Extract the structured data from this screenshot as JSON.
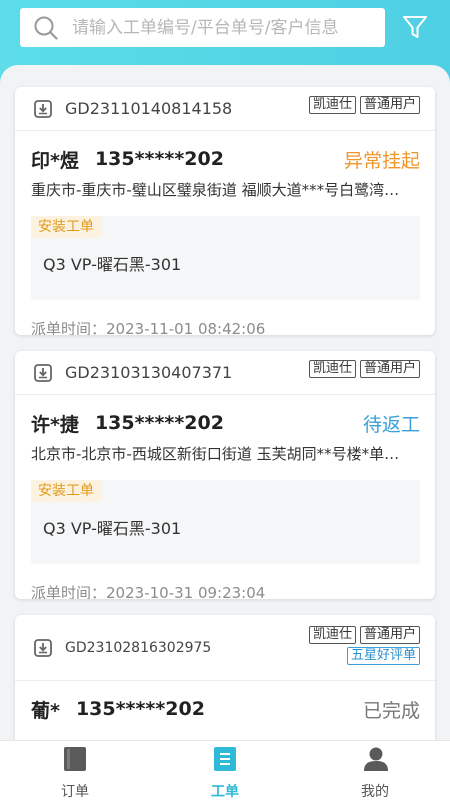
{
  "search": {
    "placeholder": "请输入工单编号/平台单号/客户信息",
    "value": ""
  },
  "colors": {
    "accent": "#2eb9d6",
    "status_suspended": "#f0962b",
    "status_pending_return": "#3aa0d8",
    "status_completed": "#777777",
    "header_bg": "#54d6e6"
  },
  "orders": [
    {
      "order_no": "GD23110140814158",
      "tags": [
        "凯迪仕",
        "普通用户"
      ],
      "extra_tags": [],
      "customer_name": "印*煜",
      "phone": "135*****202",
      "status": "异常挂起",
      "status_color": "#f0962b",
      "address": "重庆市-重庆市-璧山区璧泉街道 福顺大道***号白鹭湾…",
      "work_type": "安装工单",
      "item": "Q3 VP-曜石黑-301",
      "dispatch_label": "派单时间：",
      "dispatch_time": "2023-11-01 08:42:06"
    },
    {
      "order_no": "GD23103130407371",
      "tags": [
        "凯迪仕",
        "普通用户"
      ],
      "extra_tags": [],
      "customer_name": "许*捷",
      "phone": "135*****202",
      "status": "待返工",
      "status_color": "#3aa0d8",
      "address": "北京市-北京市-西城区新街口街道 玉芙胡同**号楼*单…",
      "work_type": "安装工单",
      "item": "Q3 VP-曜石黑-301",
      "dispatch_label": "派单时间：",
      "dispatch_time": "2023-10-31 09:23:04"
    },
    {
      "order_no": "GD23102816302975",
      "tags": [
        "凯迪仕",
        "普通用户"
      ],
      "extra_tags": [
        "五星好评单"
      ],
      "customer_name": "葡*",
      "phone": "135*****202",
      "status": "已完成",
      "status_color": "#777777"
    }
  ],
  "tabbar": {
    "items": [
      {
        "label": "订单",
        "icon": "order-book-icon",
        "active": false
      },
      {
        "label": "工单",
        "icon": "work-order-icon",
        "active": true
      },
      {
        "label": "我的",
        "icon": "user-profile-icon",
        "active": false
      }
    ]
  }
}
